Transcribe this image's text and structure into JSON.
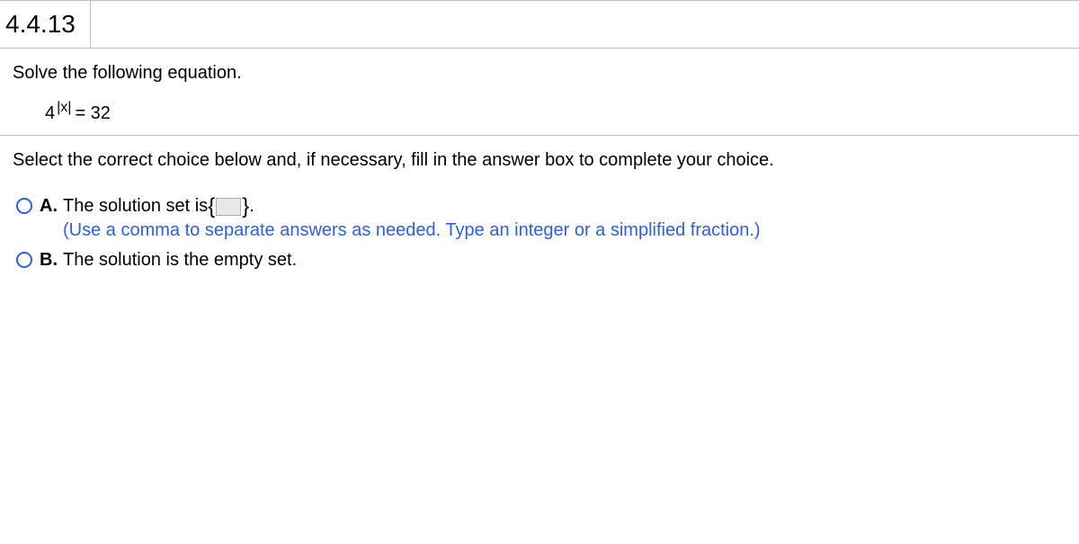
{
  "question_number": "4.4.13",
  "prompt": "Solve the following equation.",
  "equation": {
    "base": "4",
    "exponent": "|x|",
    "rhs": "= 32"
  },
  "instructions": "Select the correct choice below and, if necessary, fill in the answer box to complete your choice.",
  "choices": {
    "a": {
      "label": "A.",
      "prefix": "The solution set is ",
      "brace_open": "{",
      "brace_close": "}",
      "suffix": ".",
      "hint": "(Use a comma to separate answers as needed. Type an integer or a simplified fraction.)"
    },
    "b": {
      "label": "B.",
      "text": "The solution is the empty set."
    }
  }
}
